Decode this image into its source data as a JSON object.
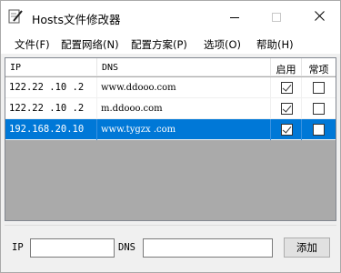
{
  "window": {
    "title": "Hosts文件修改器",
    "controls": {
      "minimize": "—",
      "maximize": "□",
      "close": "✕"
    }
  },
  "menu": [
    "文件(F)",
    "配置网络(N)",
    "配置方案(P)",
    "选项(O)",
    "帮助(H)"
  ],
  "table": {
    "columns": {
      "ip": "IP",
      "dns": "DNS",
      "enabled": "启用",
      "common": "常项"
    },
    "rows": [
      {
        "ip": "122.22 .10 .2",
        "dns": "www.ddooo.com",
        "enabled": true,
        "common": false,
        "selected": false
      },
      {
        "ip": "122.22 .10 .2",
        "dns": "m.ddooo.com",
        "enabled": true,
        "common": false,
        "selected": false
      },
      {
        "ip": "192.168.20.10",
        "dns": "www.tygzx .com",
        "enabled": true,
        "common": false,
        "selected": true
      }
    ]
  },
  "form": {
    "ip_label": "IP",
    "dns_label": "DNS",
    "ip_value": "",
    "dns_value": "",
    "add_button": "添加"
  },
  "colors": {
    "selection": "#0078d7",
    "list_background": "#aaaaaa"
  }
}
